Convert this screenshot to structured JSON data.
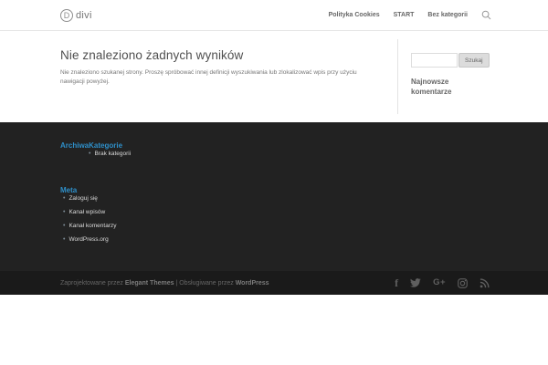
{
  "header": {
    "logo_letter": "D",
    "logo_text": "divi",
    "nav": [
      {
        "label": "Polityka Cookies"
      },
      {
        "label": "START"
      },
      {
        "label": "Bez kategorii"
      }
    ]
  },
  "main": {
    "title": "Nie znaleziono żadnych wyników",
    "description": "Nie znaleziono szukanej strony. Proszę spróbować innej definicji wyszukiwania lub zlokalizować wpis przy użyciu nawigacji powyżej."
  },
  "sidebar": {
    "search_input_value": "",
    "search_button_label": "Szukaj",
    "recent_comments_title": "Najnowsze komentarze"
  },
  "footer": {
    "archives_title": "Archiwa",
    "categories_title": "Kategorie",
    "categories_items": [
      "Brak kategorii"
    ],
    "meta_title": "Meta",
    "meta_items": [
      "Zaloguj się",
      "Kanał wpisów",
      "Kanał komentarzy",
      "WordPress.org"
    ],
    "accent_color": "#2e8fc9",
    "background_color": "#222222"
  },
  "bottom_bar": {
    "credit_prefix": "Zaprojektowane przez ",
    "credit_brand1": "Elegant Themes",
    "credit_separator": " | Obsługiwane przez ",
    "credit_brand2": "WordPress",
    "background_color": "#1a1a1a",
    "social_icons": [
      "facebook",
      "twitter",
      "google-plus",
      "instagram",
      "rss"
    ]
  }
}
